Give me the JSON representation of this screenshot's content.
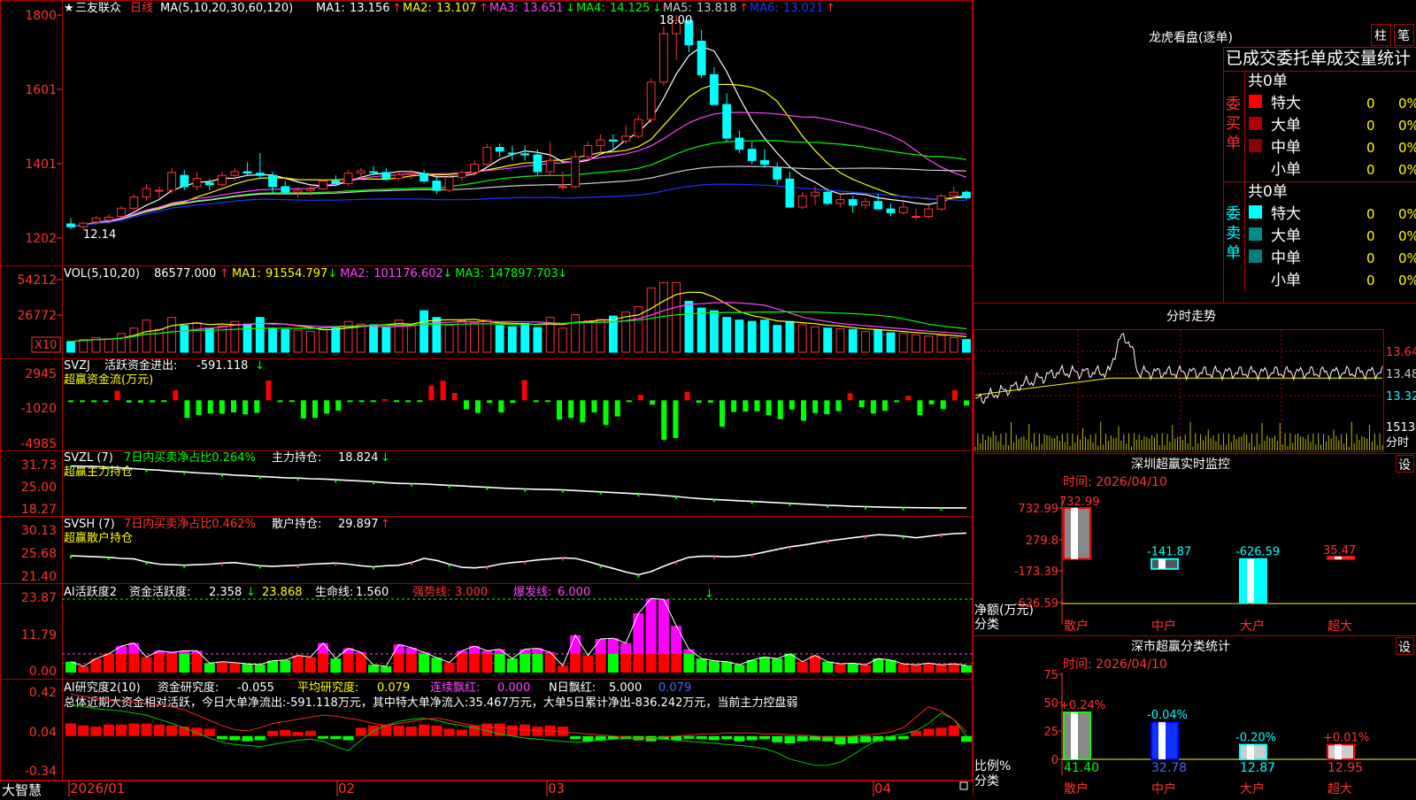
{
  "header": {
    "stock_name": "三友联众",
    "period": "日线",
    "ma_params": "MA(5,10,20,30,60,120)",
    "ma": [
      {
        "label": "MA1:",
        "value": "13.156",
        "arrow": "↑",
        "color": "#ffffff"
      },
      {
        "label": "MA2:",
        "value": "13.107",
        "arrow": "↑",
        "color": "#ffff00"
      },
      {
        "label": "MA3:",
        "value": "13.651",
        "arrow": "↓",
        "color": "#ff44ff"
      },
      {
        "label": "MA4:",
        "value": "14.125",
        "arrow": "↓",
        "color": "#00ff00"
      },
      {
        "label": "MA5:",
        "value": "13.818",
        "arrow": "↑",
        "color": "#cccccc"
      },
      {
        "label": "MA6:",
        "value": "13.021",
        "arrow": "↑",
        "color": "#2233ff"
      }
    ]
  },
  "price_panel": {
    "y_ticks": [
      "1800",
      "1601",
      "1401",
      "1202"
    ],
    "high_label": "18.00",
    "low_label": "12.14"
  },
  "vol_panel": {
    "title": "VOL(5,10,20)",
    "value": "86577.000",
    "value_arrow": "↑",
    "ma": [
      {
        "label": "MA1:",
        "value": "91554.797",
        "arrow": "↓",
        "color": "#ffff00"
      },
      {
        "label": "MA2:",
        "value": "101176.602",
        "arrow": "↓",
        "color": "#ff44ff"
      },
      {
        "label": "MA3:",
        "value": "147897.703",
        "arrow": "↓",
        "color": "#00ff00"
      }
    ],
    "y_ticks": [
      "54212",
      "26772"
    ],
    "unit_badge": "X10"
  },
  "svzj_panel": {
    "title": "SVZJ",
    "label": "活跃资金进出:",
    "value": "-591.118",
    "arrow": "↓",
    "subtitle": "超赢资金流(万元)",
    "y_ticks": [
      "2945",
      "-1020",
      "-4985"
    ]
  },
  "svzl_panel": {
    "title": "SVZL (7)",
    "ratio_label": "7日内买卖净占比0.264%",
    "hold_label": "主力持仓:",
    "hold_value": "18.824",
    "arrow": "↓",
    "subtitle": "超赢主力持仓",
    "y_ticks": [
      "31.73",
      "25.00",
      "18.27"
    ]
  },
  "svsh_panel": {
    "title": "SVSH (7)",
    "ratio_label": "7日内买卖净占比0.462%",
    "hold_label": "散户持仓:",
    "hold_value": "29.897",
    "arrow": "↑",
    "subtitle": "超赢散户持仓",
    "y_ticks": [
      "30.13",
      "25.68",
      "21.40"
    ]
  },
  "ai_active_panel": {
    "title": "AI活跃度2",
    "label": "资金活跃度:",
    "value": "2.358",
    "arrow": "↓",
    "value2": "23.868",
    "life_label": "生命线:",
    "life_value": "1.560",
    "strong_label": "强势线:",
    "strong_value": "3.000",
    "burst_label": "爆发线:",
    "burst_value": "6.000",
    "y_ticks": [
      "23.87",
      "11.79",
      "0.00"
    ]
  },
  "ai_research_panel": {
    "title": "AI研究度2(10)",
    "label": "资金研究度:",
    "value": "-0.055",
    "avg_label": "平均研究度:",
    "avg_value": "0.079",
    "lian_label": "连续飘红:",
    "lian_value": "0.000",
    "n_label": "N日飘红:",
    "n_value": "5.000",
    "last_value": "0.079",
    "summary": "总体近期大资金相对活跃，今日大单净流出:-591.118万元，其中特大单净流入:35.467万元，大单5日累计净出-836.242万元，当前主力控盘弱",
    "y_ticks": [
      "0.42",
      "0.04",
      "-0.34"
    ]
  },
  "x_axis": {
    "brand": "大智慧",
    "labels": [
      "2026/01",
      "02",
      "03",
      "04"
    ]
  },
  "right_panel": {
    "dragon_title": "龙虎看盘(逐单)",
    "tab_column": "柱",
    "tab_pen": "笔",
    "stats_title": "已成交委托单成交量统计",
    "buy_side_label": "委买单",
    "sell_side_label": "委卖单",
    "buy_total": "共0单",
    "sell_total": "共0单",
    "buy_rows": [
      {
        "name": "特大",
        "count": "0",
        "pct": "0%",
        "color": "#ff0000"
      },
      {
        "name": "大单",
        "count": "0",
        "pct": "0%",
        "color": "#aa0000"
      },
      {
        "name": "中单",
        "count": "0",
        "pct": "0%",
        "color": "#880000"
      },
      {
        "name": "小单",
        "count": "0",
        "pct": "0%",
        "color": "#000000"
      }
    ],
    "sell_rows": [
      {
        "name": "特大",
        "count": "0",
        "pct": "0%",
        "color": "#00ffff"
      },
      {
        "name": "大单",
        "count": "0",
        "pct": "0%",
        "color": "#008b8b"
      },
      {
        "name": "中单",
        "count": "0",
        "pct": "0%",
        "color": "#008080"
      },
      {
        "name": "小单",
        "count": "0",
        "pct": "0%",
        "color": "#000000"
      }
    ],
    "intraday_title": "分时走势",
    "intraday_prices": [
      "13.64",
      "13.48",
      "13.32"
    ],
    "intraday_vol": "1513",
    "intraday_vol_label": "分时",
    "sz_monitor_title": "深圳超赢实时监控",
    "sz_monitor_btn": "设",
    "sz_time": "时间: 2026/04/10",
    "sz_y_ticks": [
      "732.99",
      "279.8",
      "-173.39",
      "-626.59"
    ],
    "sz_y_label": "净额(万元)",
    "sz_x_label": "分类",
    "sz_categories": [
      "散户",
      "中户",
      "大户",
      "超大"
    ],
    "sz_values": [
      732.99,
      -141.87,
      -626.59,
      35.47
    ],
    "sz_value_labels": [
      "732.99",
      "-141.87",
      "-626.59",
      "35.47"
    ],
    "sc_stats_title": "深市超赢分类统计",
    "sc_stats_btn": "设",
    "sc_time": "时间: 2026/04/10",
    "sc_y_ticks": [
      "75",
      "50",
      "25",
      "0"
    ],
    "sc_y_label": "比例%",
    "sc_x_label": "分类",
    "sc_categories": [
      "散户",
      "中户",
      "大户",
      "超大"
    ],
    "sc_values": [
      41.4,
      32.78,
      12.87,
      12.95
    ],
    "sc_value_labels": [
      "41.40",
      "32.78",
      "12.87",
      "12.95"
    ],
    "sc_change_labels": [
      "+0.24%",
      "-0.04%",
      "-0.20%",
      "+0.01%"
    ]
  },
  "chart_data": [
    {
      "type": "candlestick",
      "title": "三友联众 日线",
      "ylim": [
        12.02,
        18.0
      ],
      "max_label": 18.0,
      "min_label": 12.14,
      "ohlc": [
        [
          12.4,
          12.55,
          12.25,
          12.32
        ],
        [
          12.32,
          12.45,
          12.22,
          12.42
        ],
        [
          12.45,
          12.62,
          12.38,
          12.56
        ],
        [
          12.5,
          12.65,
          12.4,
          12.58
        ],
        [
          12.6,
          12.88,
          12.55,
          12.82
        ],
        [
          12.82,
          13.2,
          12.78,
          13.12
        ],
        [
          13.12,
          13.45,
          13.02,
          13.35
        ],
        [
          13.3,
          13.4,
          13.1,
          13.3
        ],
        [
          13.3,
          13.9,
          13.2,
          13.78
        ],
        [
          13.7,
          13.85,
          13.3,
          13.4
        ],
        [
          13.4,
          13.8,
          13.3,
          13.62
        ],
        [
          13.5,
          13.6,
          13.3,
          13.45
        ],
        [
          13.45,
          13.8,
          13.4,
          13.7
        ],
        [
          13.7,
          13.9,
          13.55,
          13.8
        ],
        [
          13.8,
          14.05,
          13.7,
          13.76
        ],
        [
          13.76,
          14.3,
          13.6,
          13.7
        ],
        [
          13.7,
          13.8,
          13.2,
          13.4
        ],
        [
          13.4,
          13.55,
          13.18,
          13.25
        ],
        [
          13.25,
          13.4,
          13.1,
          13.3
        ],
        [
          13.3,
          13.42,
          13.15,
          13.34
        ],
        [
          13.34,
          13.6,
          13.3,
          13.55
        ],
        [
          13.55,
          13.7,
          13.4,
          13.48
        ],
        [
          13.48,
          13.85,
          13.42,
          13.76
        ],
        [
          13.76,
          13.9,
          13.6,
          13.82
        ],
        [
          13.8,
          13.95,
          13.7,
          13.78
        ],
        [
          13.78,
          13.9,
          13.55,
          13.62
        ],
        [
          13.62,
          13.8,
          13.55,
          13.72
        ],
        [
          13.72,
          13.85,
          13.6,
          13.75
        ],
        [
          13.75,
          13.85,
          13.5,
          13.55
        ],
        [
          13.55,
          13.65,
          13.2,
          13.3
        ],
        [
          13.3,
          13.7,
          13.25,
          13.65
        ],
        [
          13.65,
          13.85,
          13.55,
          13.78
        ],
        [
          13.78,
          14.1,
          13.7,
          14.0
        ],
        [
          14.0,
          14.55,
          13.95,
          14.45
        ],
        [
          14.45,
          14.55,
          14.2,
          14.35
        ],
        [
          14.3,
          14.5,
          14.1,
          14.28
        ],
        [
          14.28,
          14.5,
          14.1,
          14.25
        ],
        [
          14.25,
          14.4,
          13.7,
          13.8
        ],
        [
          13.8,
          14.6,
          13.7,
          14.1
        ],
        [
          13.4,
          13.8,
          13.3,
          13.4
        ],
        [
          13.4,
          14.35,
          13.35,
          14.2
        ],
        [
          14.2,
          14.6,
          14.1,
          14.5
        ],
        [
          14.5,
          14.8,
          14.3,
          14.65
        ],
        [
          14.65,
          14.8,
          14.4,
          14.62
        ],
        [
          14.62,
          15.05,
          14.55,
          14.75
        ],
        [
          14.75,
          15.3,
          14.7,
          15.2
        ],
        [
          15.2,
          16.3,
          15.1,
          16.2
        ],
        [
          16.2,
          17.7,
          16.1,
          17.5
        ],
        [
          17.5,
          18.0,
          16.8,
          17.85
        ],
        [
          17.85,
          17.9,
          17.0,
          17.2
        ],
        [
          17.3,
          17.6,
          16.3,
          16.4
        ],
        [
          16.4,
          16.6,
          15.9,
          15.6
        ],
        [
          15.6,
          15.9,
          14.6,
          14.7
        ],
        [
          14.7,
          14.9,
          14.3,
          14.4
        ],
        [
          14.4,
          14.6,
          14.0,
          14.1
        ],
        [
          14.1,
          14.4,
          13.9,
          14.0
        ],
        [
          13.9,
          14.05,
          13.45,
          13.6
        ],
        [
          13.6,
          13.8,
          12.95,
          12.85
        ],
        [
          12.85,
          13.25,
          12.8,
          13.15
        ],
        [
          13.15,
          13.4,
          12.9,
          13.25
        ],
        [
          13.25,
          13.35,
          12.9,
          12.95
        ],
        [
          12.95,
          13.2,
          12.85,
          13.05
        ],
        [
          13.05,
          13.15,
          12.7,
          12.9
        ],
        [
          12.9,
          13.1,
          12.8,
          13.0
        ],
        [
          13.0,
          13.2,
          12.9,
          12.8
        ],
        [
          12.8,
          12.95,
          12.6,
          12.7
        ],
        [
          12.7,
          13.0,
          12.65,
          12.85
        ],
        [
          12.6,
          12.8,
          12.5,
          12.6
        ],
        [
          12.6,
          12.9,
          12.55,
          12.8
        ],
        [
          12.8,
          13.2,
          12.75,
          13.15
        ],
        [
          13.15,
          13.4,
          13.05,
          13.25
        ],
        [
          13.25,
          13.3,
          13.05,
          13.1
        ]
      ],
      "ma_series": [
        {
          "name": "MA1",
          "last": 13.156,
          "color": "#ffffff"
        },
        {
          "name": "MA2",
          "last": 13.107,
          "color": "#ffff00"
        },
        {
          "name": "MA3",
          "last": 13.651,
          "color": "#ff44ff"
        },
        {
          "name": "MA4",
          "last": 14.125,
          "color": "#00ff00"
        },
        {
          "name": "MA5",
          "last": 13.818,
          "color": "#cccccc"
        },
        {
          "name": "MA6",
          "last": 13.021,
          "color": "#2233ff"
        }
      ]
    },
    {
      "type": "bar",
      "title": "VOL(5,10,20)",
      "unit": "X10",
      "ylim": [
        0,
        54212
      ],
      "values": [
        8000,
        9500,
        11000,
        10000,
        14000,
        18000,
        24000,
        17000,
        26000,
        20000,
        22000,
        18000,
        19500,
        23000,
        21000,
        26000,
        18000,
        17000,
        16500,
        15500,
        17000,
        19000,
        23000,
        21000,
        20500,
        19000,
        24000,
        20000,
        31000,
        26000,
        20000,
        23500,
        22000,
        24000,
        20000,
        19000,
        21500,
        18500,
        26000,
        18000,
        28000,
        23500,
        24500,
        27000,
        30000,
        34000,
        48000,
        52000,
        52000,
        38000,
        33000,
        31000,
        26000,
        24000,
        23000,
        24000,
        20000,
        23000,
        20500,
        19000,
        18000,
        17500,
        17000,
        15500,
        16500,
        14500,
        14000,
        13000,
        12000,
        12500,
        11000,
        9500
      ]
    },
    {
      "type": "bar",
      "title": "SVZJ 活跃资金进出",
      "ylim": [
        -4985,
        2945
      ],
      "values": [
        -210,
        -200,
        -190,
        -180,
        1080,
        -250,
        -260,
        -220,
        -140,
        1120,
        -1990,
        -1660,
        -1500,
        -1540,
        -1370,
        -1590,
        -1430,
        2240,
        -200,
        -150,
        -2050,
        -1990,
        -1520,
        -1170,
        -130,
        -150,
        -100,
        130,
        -170,
        -150,
        -140,
        1640,
        2230,
        840,
        -1030,
        -1440,
        -300,
        -1380,
        -300,
        2300,
        -200,
        -190,
        -2200,
        -2000,
        -2500,
        -1380,
        -2800,
        -1830,
        -200,
        600,
        -500,
        -4480,
        -4270,
        930,
        -280,
        -260,
        -3000,
        -1320,
        -1280,
        -1260,
        -1700,
        -2150,
        -1050,
        -2320,
        -1450,
        -1580,
        -1250,
        780,
        -790,
        -1500,
        -1190,
        -180,
        520,
        -1680,
        -450,
        -1000,
        1170,
        -590
      ]
    },
    {
      "type": "line",
      "title": "SVZL 主力持仓",
      "ylim": [
        18.27,
        31.73
      ],
      "values": [
        31.6,
        31.5,
        31.4,
        31.2,
        31.0,
        30.8,
        30.5,
        30.3,
        30.0,
        29.8,
        29.5,
        29.3,
        29.1,
        28.8,
        28.6,
        28.4,
        28.2,
        28.0,
        27.9,
        27.7,
        27.6,
        27.4,
        27.2,
        27.0,
        26.8,
        26.5,
        26.3,
        26.2,
        26.1,
        25.9,
        25.7,
        25.5,
        25.3,
        25.1,
        24.9,
        24.7,
        24.6,
        24.5,
        24.4,
        24.3,
        24.1,
        23.9,
        23.7,
        23.5,
        23.3,
        23.1,
        22.9,
        22.6,
        22.3,
        21.9,
        21.6,
        21.4,
        21.2,
        21.0,
        20.8,
        20.6,
        20.4,
        20.2,
        20.0,
        19.8,
        19.6,
        19.5,
        19.3,
        19.2,
        19.1,
        19.0,
        18.95,
        18.9,
        18.85,
        18.83,
        18.83,
        18.824
      ]
    },
    {
      "type": "line",
      "title": "SVSH 散户持仓",
      "ylim": [
        21.4,
        30.13
      ],
      "values": [
        25.6,
        25.5,
        25.4,
        25.3,
        25.1,
        25.0,
        24.4,
        24.0,
        23.9,
        23.8,
        23.9,
        24.0,
        24.2,
        24.3,
        24.0,
        23.7,
        23.6,
        23.7,
        23.8,
        24.0,
        24.1,
        24.2,
        24.0,
        23.7,
        23.5,
        23.7,
        23.8,
        24.3,
        25.1,
        24.7,
        24.0,
        23.4,
        23.3,
        23.5,
        24.0,
        24.3,
        24.5,
        24.8,
        25.0,
        25.2,
        25.1,
        24.5,
        23.8,
        23.2,
        22.5,
        22.0,
        22.6,
        23.6,
        24.5,
        25.3,
        25.5,
        25.5,
        25.4,
        25.5,
        25.8,
        26.3,
        26.8,
        27.3,
        27.6,
        28.0,
        28.4,
        28.7,
        29.0,
        29.3,
        29.6,
        29.5,
        29.3,
        29.0,
        29.3,
        29.6,
        29.8,
        29.897
      ]
    },
    {
      "type": "bar",
      "title": "AI活跃度2 资金活跃度",
      "ylim": [
        0,
        23.87
      ],
      "values": [
        3.5,
        2.0,
        4.5,
        6.0,
        8.5,
        9.5,
        5.0,
        7.0,
        6.5,
        7.0,
        7.0,
        3.0,
        3.5,
        3.2,
        2.8,
        2.6,
        3.8,
        4.0,
        5.5,
        5.0,
        9.5,
        4.5,
        7.8,
        6.5,
        2.5,
        2.0,
        9.0,
        8.0,
        6.5,
        4.8,
        3.2,
        7.0,
        8.5,
        7.0,
        7.5,
        4.5,
        7.5,
        7.8,
        6.5,
        2.2,
        12.0,
        5.5,
        10.8,
        11.0,
        9.5,
        19.0,
        23.8,
        23.5,
        15.0,
        7.5,
        4.5,
        3.8,
        3.5,
        2.5,
        4.0,
        5.0,
        4.5,
        6.0,
        3.5,
        5.5,
        3.5,
        2.8,
        3.0,
        2.5,
        4.5,
        4.0,
        2.8,
        2.5,
        3.0,
        2.5,
        2.8,
        2.358
      ]
    },
    {
      "type": "bar",
      "title": "AI研究度2(10) 资金研究度",
      "ylim": [
        -0.34,
        0.42
      ],
      "values": [
        0.12,
        0.1,
        0.09,
        0.11,
        0.11,
        0.12,
        0.12,
        0.11,
        0.1,
        0.09,
        0.08,
        0.07,
        -0.03,
        -0.04,
        -0.05,
        -0.04,
        0.05,
        0.06,
        0.04,
        0.05,
        -0.02,
        -0.03,
        -0.04,
        0.08,
        0.1,
        0.11,
        0.1,
        0.09,
        0.11,
        0.1,
        0.07,
        0.06,
        0.1,
        0.12,
        0.12,
        0.1,
        0.11,
        0.09,
        0.1,
        0.09,
        -0.03,
        -0.05,
        -0.04,
        -0.03,
        -0.03,
        -0.04,
        -0.05,
        -0.03,
        -0.04,
        -0.02,
        -0.03,
        -0.04,
        -0.03,
        -0.05,
        -0.04,
        -0.03,
        -0.06,
        -0.07,
        -0.05,
        -0.04,
        -0.05,
        -0.08,
        -0.07,
        -0.06,
        -0.05,
        -0.04,
        -0.03,
        0.05,
        0.07,
        0.08,
        0.1,
        -0.055
      ]
    }
  ]
}
